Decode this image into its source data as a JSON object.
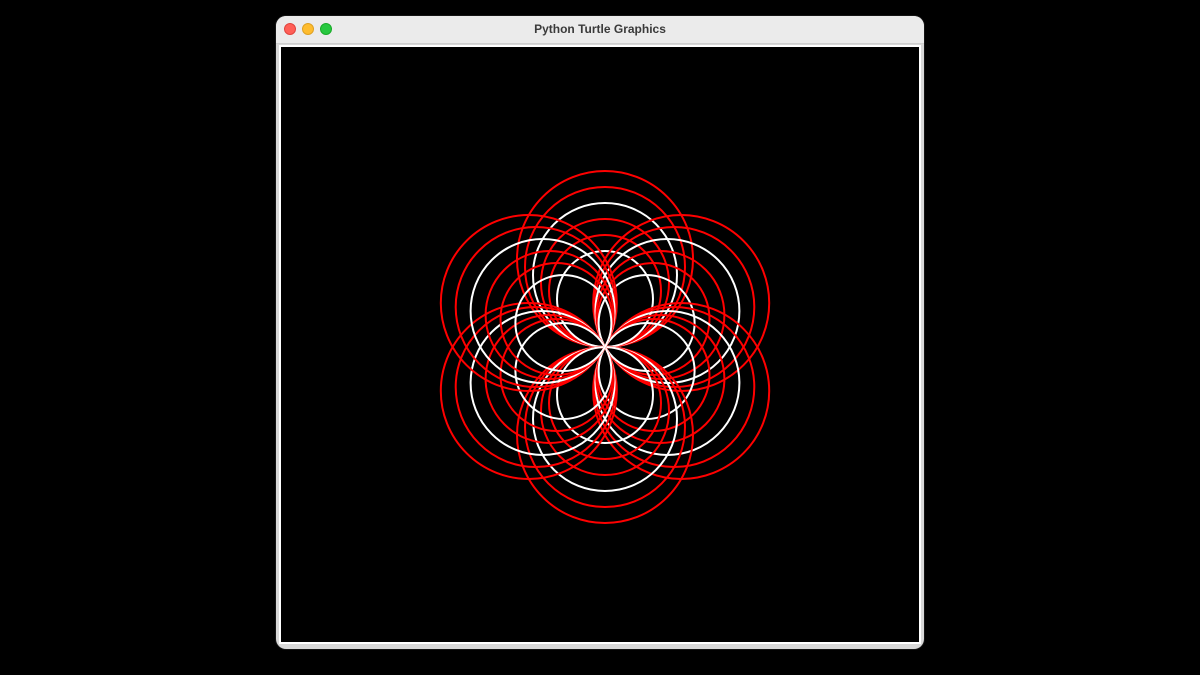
{
  "window": {
    "title": "Python Turtle Graphics",
    "controls": {
      "close_color": "#ff5f57",
      "minimize_color": "#febc2e",
      "maximize_color": "#28c840"
    }
  },
  "canvas": {
    "background": "#000000",
    "drawing": {
      "description_colors": [
        "#ff0000",
        "#ffffff"
      ],
      "petal_count": 6
    }
  }
}
